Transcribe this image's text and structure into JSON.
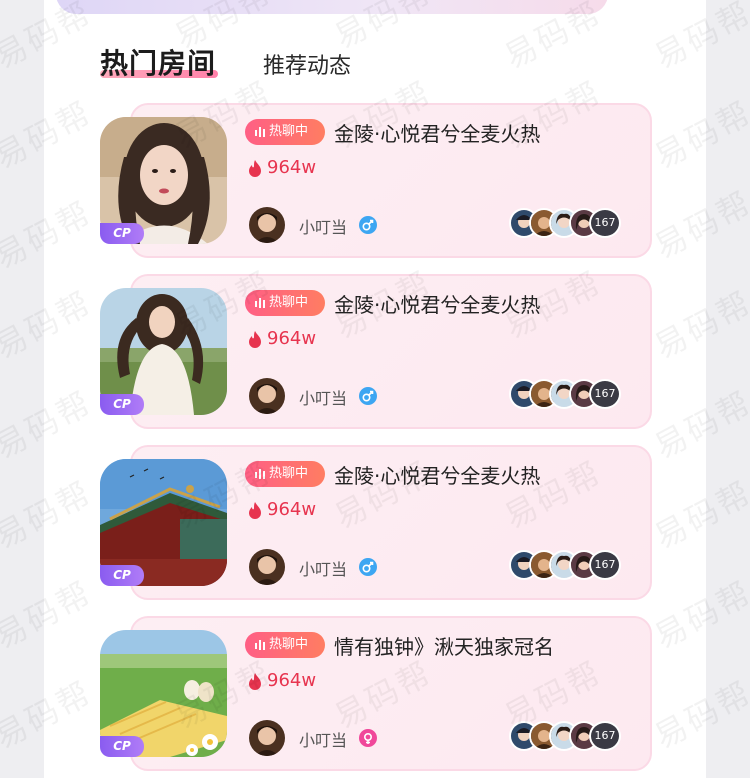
{
  "tabs": {
    "hot_rooms": "热门房间",
    "feed": "推荐动态"
  },
  "rooms": [
    {
      "tag": "热聊中",
      "name": "金陵·心悦君兮全麦火热",
      "heat": "964w",
      "host": "小叮当",
      "gender": "male",
      "badge": "CP",
      "audience_count": "167",
      "cover": "portrait-girl"
    },
    {
      "tag": "热聊中",
      "name": "金陵·心悦君兮全麦火热",
      "heat": "964w",
      "host": "小叮当",
      "gender": "male",
      "badge": "CP",
      "audience_count": "167",
      "cover": "girl-outdoors"
    },
    {
      "tag": "热聊中",
      "name": "金陵·心悦君兮全麦火热",
      "heat": "964w",
      "host": "小叮当",
      "gender": "male",
      "badge": "CP",
      "audience_count": "167",
      "cover": "temple-roof"
    },
    {
      "tag": "热聊中",
      "name": "情有独钟》湫天独家冠名",
      "heat": "964w",
      "host": "小叮当",
      "gender": "female",
      "badge": "CP",
      "audience_count": "167",
      "cover": "picnic-field"
    }
  ],
  "watermark": "易码帮",
  "colors": {
    "accent_tag": "#ff5f85",
    "heat": "#e7344f",
    "card_bg": "#fdeef3",
    "cp_badge": "#8a5cf0",
    "male": "#3da6f2",
    "female": "#f0479a"
  }
}
